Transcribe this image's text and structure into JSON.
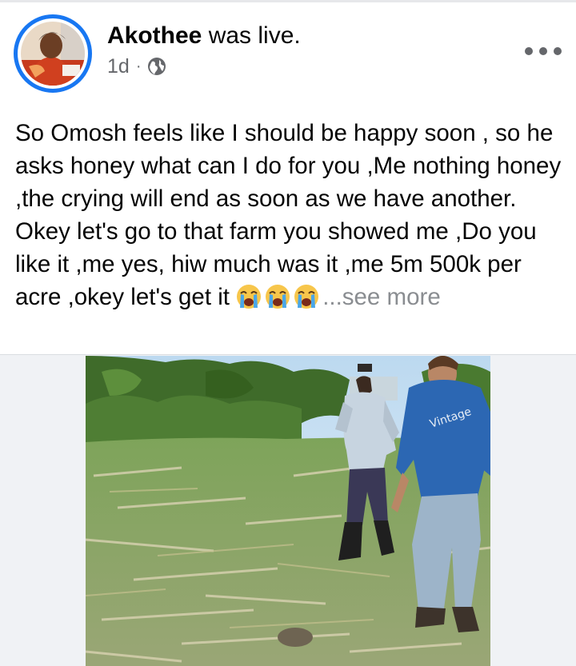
{
  "post": {
    "author": "Akothee",
    "action": "was live.",
    "time": "1d",
    "separator": "·",
    "audience_icon": "globe-icon",
    "more_icon": "more-options-icon",
    "text": "So Omosh feels like I should be happy soon , so he asks honey what can I do for you ,Me nothing honey ,the crying will end as soon as we have another.  Okey let's go to that farm you showed me ,Do you like it ,me yes, hiw much was it ,me 5m 500k per acre ,okey let's get it",
    "emojis": [
      "crying-face-icon",
      "crying-face-icon",
      "crying-face-icon"
    ],
    "see_more": "...see more"
  },
  "colors": {
    "accent": "#1877f2",
    "text": "#050505",
    "secondary": "#65676b",
    "see_more": "#8a8d91"
  }
}
